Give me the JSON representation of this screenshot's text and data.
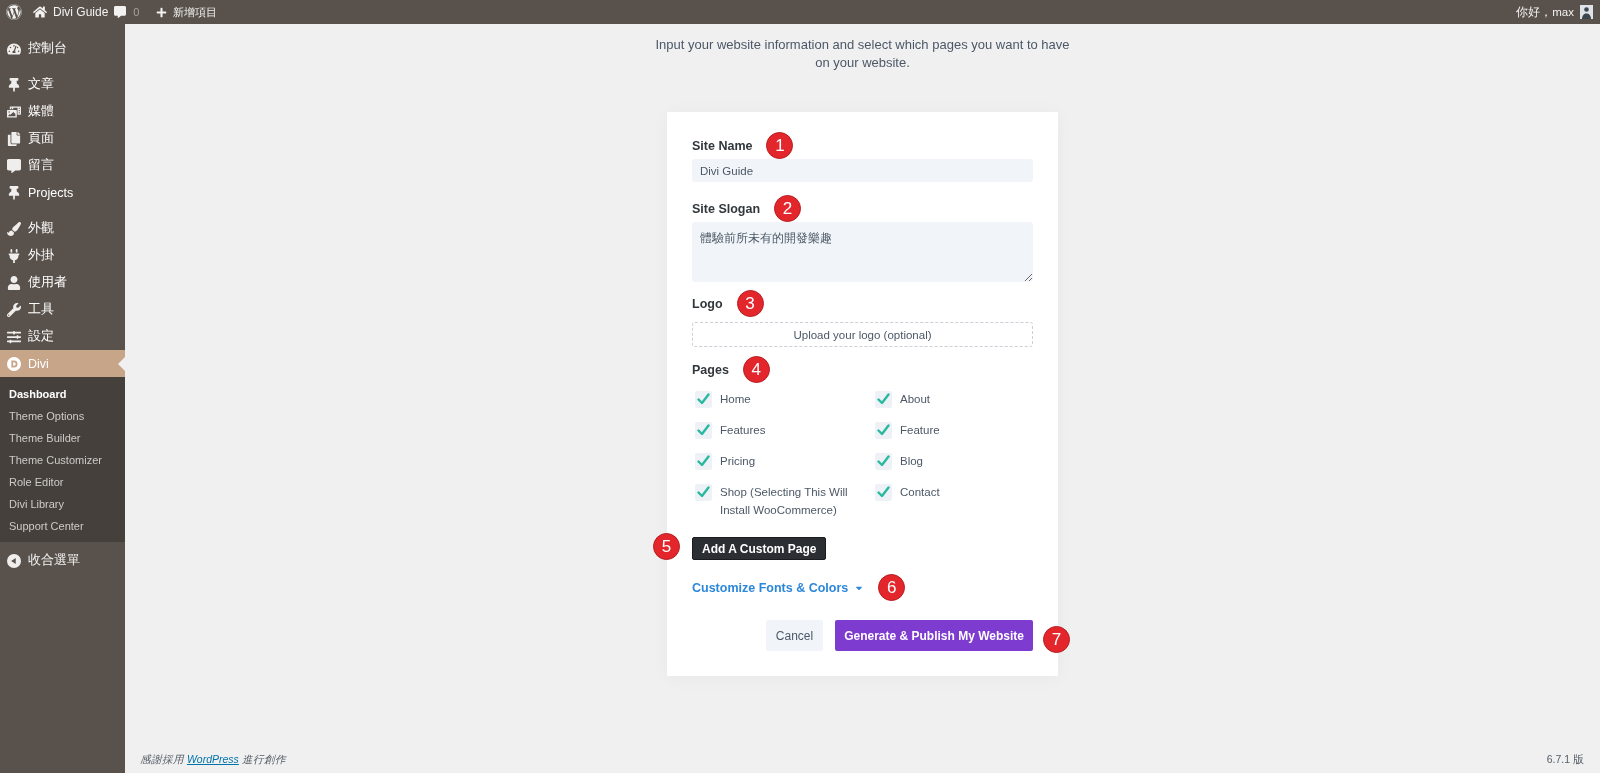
{
  "admin_bar": {
    "site_name": "Divi Guide",
    "comments": "0",
    "new_item": "新增項目",
    "greeting": "你好，max"
  },
  "sidebar": {
    "sections": [
      {
        "items": [
          {
            "label": "控制台",
            "selected": false
          }
        ]
      },
      {
        "items": [
          {
            "label": "文章",
            "selected": false
          },
          {
            "label": "媒體",
            "selected": false
          },
          {
            "label": "頁面",
            "selected": false
          },
          {
            "label": "留言",
            "selected": false
          },
          {
            "label": "Projects",
            "selected": false
          }
        ]
      },
      {
        "items": [
          {
            "label": "外觀",
            "selected": false
          },
          {
            "label": "外掛",
            "selected": false
          },
          {
            "label": "使用者",
            "selected": false
          },
          {
            "label": "工具",
            "selected": false
          },
          {
            "label": "設定",
            "selected": false
          },
          {
            "label": "Divi",
            "selected": true,
            "submenu": [
              {
                "label": "Dashboard",
                "selected": true
              },
              {
                "label": "Theme Options",
                "selected": false
              },
              {
                "label": "Theme Builder",
                "selected": false
              },
              {
                "label": "Theme Customizer",
                "selected": false
              },
              {
                "label": "Role Editor",
                "selected": false
              },
              {
                "label": "Divi Library",
                "selected": false
              },
              {
                "label": "Support Center",
                "selected": false
              }
            ]
          }
        ]
      }
    ],
    "collapse": "收合選單"
  },
  "intro": "Input your website information and select which pages you want to have on your website.",
  "form": {
    "site_name": {
      "label": "Site Name",
      "step": "1",
      "value": "Divi Guide"
    },
    "site_slogan": {
      "label": "Site Slogan",
      "step": "2",
      "value": "體驗前所未有的開發樂趣"
    },
    "logo": {
      "label": "Logo",
      "step": "3",
      "upload": "Upload your logo (optional)"
    },
    "pages": {
      "label": "Pages",
      "step": "4",
      "items": [
        {
          "label": "Home",
          "checked": true
        },
        {
          "label": "About",
          "checked": true
        },
        {
          "label": "Features",
          "checked": true
        },
        {
          "label": "Feature",
          "checked": true
        },
        {
          "label": "Pricing",
          "checked": true
        },
        {
          "label": "Blog",
          "checked": true
        },
        {
          "label": "Shop (Selecting This Will Install WooCommerce)",
          "checked": true
        },
        {
          "label": "Contact",
          "checked": true
        }
      ]
    },
    "add_page": {
      "label": "Add A Custom Page",
      "step": "5"
    },
    "customize": {
      "label": "Customize Fonts & Colors",
      "step": "6"
    },
    "actions": [
      {
        "label": "Cancel",
        "kind": "secondary"
      },
      {
        "label": "Generate & Publish My Website",
        "kind": "primary",
        "step": "7"
      }
    ]
  },
  "footer": {
    "before": "感謝採用",
    "link": "WordPress",
    "after": "進行創作",
    "version": "6.7.1 版"
  }
}
